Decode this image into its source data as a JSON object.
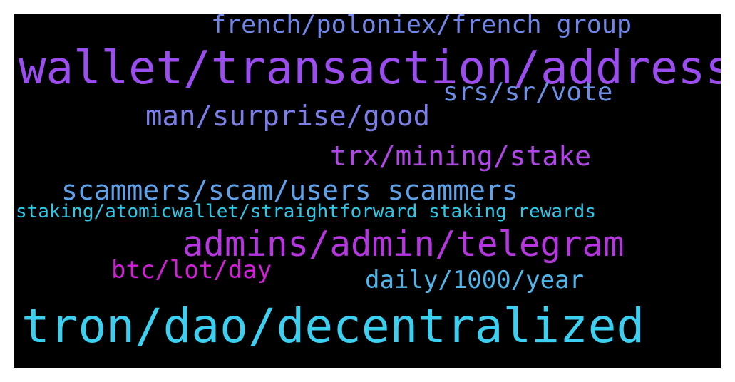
{
  "background": "#000000",
  "words": [
    {
      "text": "french/poloniex/french group",
      "color": "#6f86e8"
    },
    {
      "text": "wallet/transaction/address",
      "color": "#9b4df0"
    },
    {
      "text": "srs/sr/vote",
      "color": "#6b90e6"
    },
    {
      "text": "man/surprise/good",
      "color": "#7b7de8"
    },
    {
      "text": "trx/mining/stake",
      "color": "#b146e6"
    },
    {
      "text": "scammers/scam/users scammers",
      "color": "#5fa2ea"
    },
    {
      "text": "staking/atomicwallet/straightforward staking rewards",
      "color": "#2ec8e6"
    },
    {
      "text": "admins/admin/telegram",
      "color": "#b637df"
    },
    {
      "text": "btc/lot/day",
      "color": "#d21fd8"
    },
    {
      "text": "daily/1000/year",
      "color": "#4fb6ec"
    },
    {
      "text": "tron/dao/decentralized",
      "color": "#3ccff0"
    }
  ]
}
